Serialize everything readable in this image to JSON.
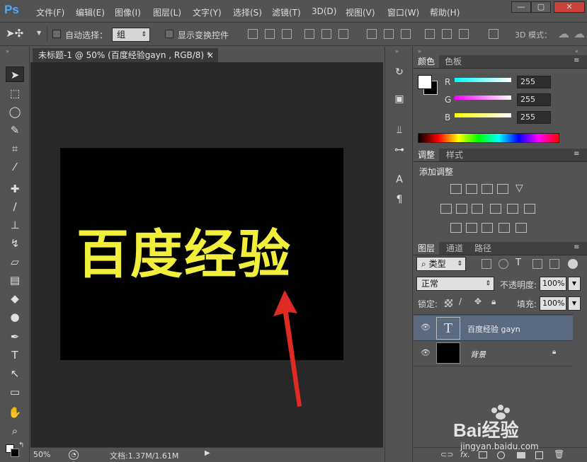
{
  "app": {
    "logo": "Ps",
    "menu": [
      "文件(F)",
      "编辑(E)",
      "图像(I)",
      "图层(L)",
      "文字(Y)",
      "选择(S)",
      "滤镜(T)",
      "3D(D)",
      "视图(V)",
      "窗口(W)",
      "帮助(H)"
    ],
    "window_controls": {
      "minimize": "—",
      "restore": "▢",
      "close": "✕"
    }
  },
  "options": {
    "auto_select_label": "自动选择：",
    "auto_select_value": "组",
    "show_transform_label": "显示变换控件",
    "mode_3d_label": "3D 模式："
  },
  "document": {
    "tab_title": "未标题-1 @ 50% (百度经验gayn , RGB/8) *",
    "tab_close": "×",
    "art_text": "百度经验",
    "art_text_color": "#f2ef3c",
    "art_bg_color": "#000000",
    "zoom": "50%",
    "doc_size": "文档:1.37M/1.61M"
  },
  "color_panel": {
    "tabs": [
      "颜色",
      "色板"
    ],
    "channels": [
      {
        "label": "R",
        "value": "255"
      },
      {
        "label": "G",
        "value": "255"
      },
      {
        "label": "B",
        "value": "255"
      }
    ]
  },
  "adjust_panel": {
    "tabs": [
      "调整",
      "样式"
    ],
    "title": "添加调整"
  },
  "layers_panel": {
    "tabs": [
      "图层",
      "通道",
      "路径"
    ],
    "filter_label": "类型",
    "blend_mode": "正常",
    "opacity_label": "不透明度:",
    "opacity_value": "100%",
    "lock_label": "锁定:",
    "fill_label": "填充:",
    "fill_value": "100%",
    "layers": [
      {
        "name": "百度经验 gayn",
        "thumb": "T",
        "selected": true
      },
      {
        "name": "背景",
        "thumb": "",
        "selected": false
      }
    ],
    "footer_icons": [
      "link-icon",
      "fx-icon",
      "mask-icon",
      "adjustment-icon",
      "folder-icon",
      "new-layer-icon",
      "trash-icon"
    ],
    "fx_label": "fx."
  },
  "watermark": {
    "brand": "Bai经验",
    "url": "jingyan.baidu.com"
  }
}
